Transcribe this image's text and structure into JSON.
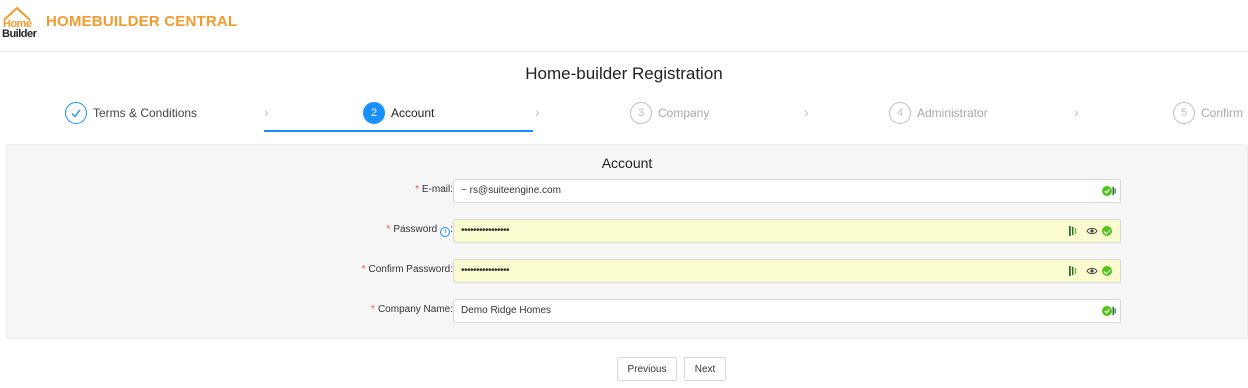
{
  "header": {
    "logo_line1": "Home",
    "logo_line2": "Builder",
    "brand": "HOMEBUILDER CENTRAL",
    "brand_color": "#f39a2d"
  },
  "page_title": "Home-builder Registration",
  "steps": [
    {
      "number": "✓",
      "label": "Terms & Conditions",
      "status": "done"
    },
    {
      "number": "2",
      "label": "Account",
      "status": "active"
    },
    {
      "number": "3",
      "label": "Company",
      "status": "todo"
    },
    {
      "number": "4",
      "label": "Administrator",
      "status": "todo"
    },
    {
      "number": "5",
      "label": "Confirm",
      "status": "todo"
    }
  ],
  "form": {
    "title": "Account",
    "fields": [
      {
        "label": "E-mail",
        "required": true,
        "value": "~        rs@suiteengine.com",
        "type": "email"
      },
      {
        "label": "Password",
        "required": true,
        "value": "••••••••••••••••",
        "type": "password",
        "has_info": true
      },
      {
        "label": "Confirm Password",
        "required": true,
        "value": "••••••••••••••••",
        "type": "password"
      },
      {
        "label": "Company Name",
        "required": true,
        "value": "Demo Ridge Homes",
        "type": "text"
      }
    ]
  },
  "buttons": {
    "previous": "Previous",
    "next": "Next"
  },
  "colors": {
    "accent": "#1890ff",
    "required": "#ff4d4f",
    "autofill": "#fbfbd0",
    "success": "#52c41a"
  }
}
